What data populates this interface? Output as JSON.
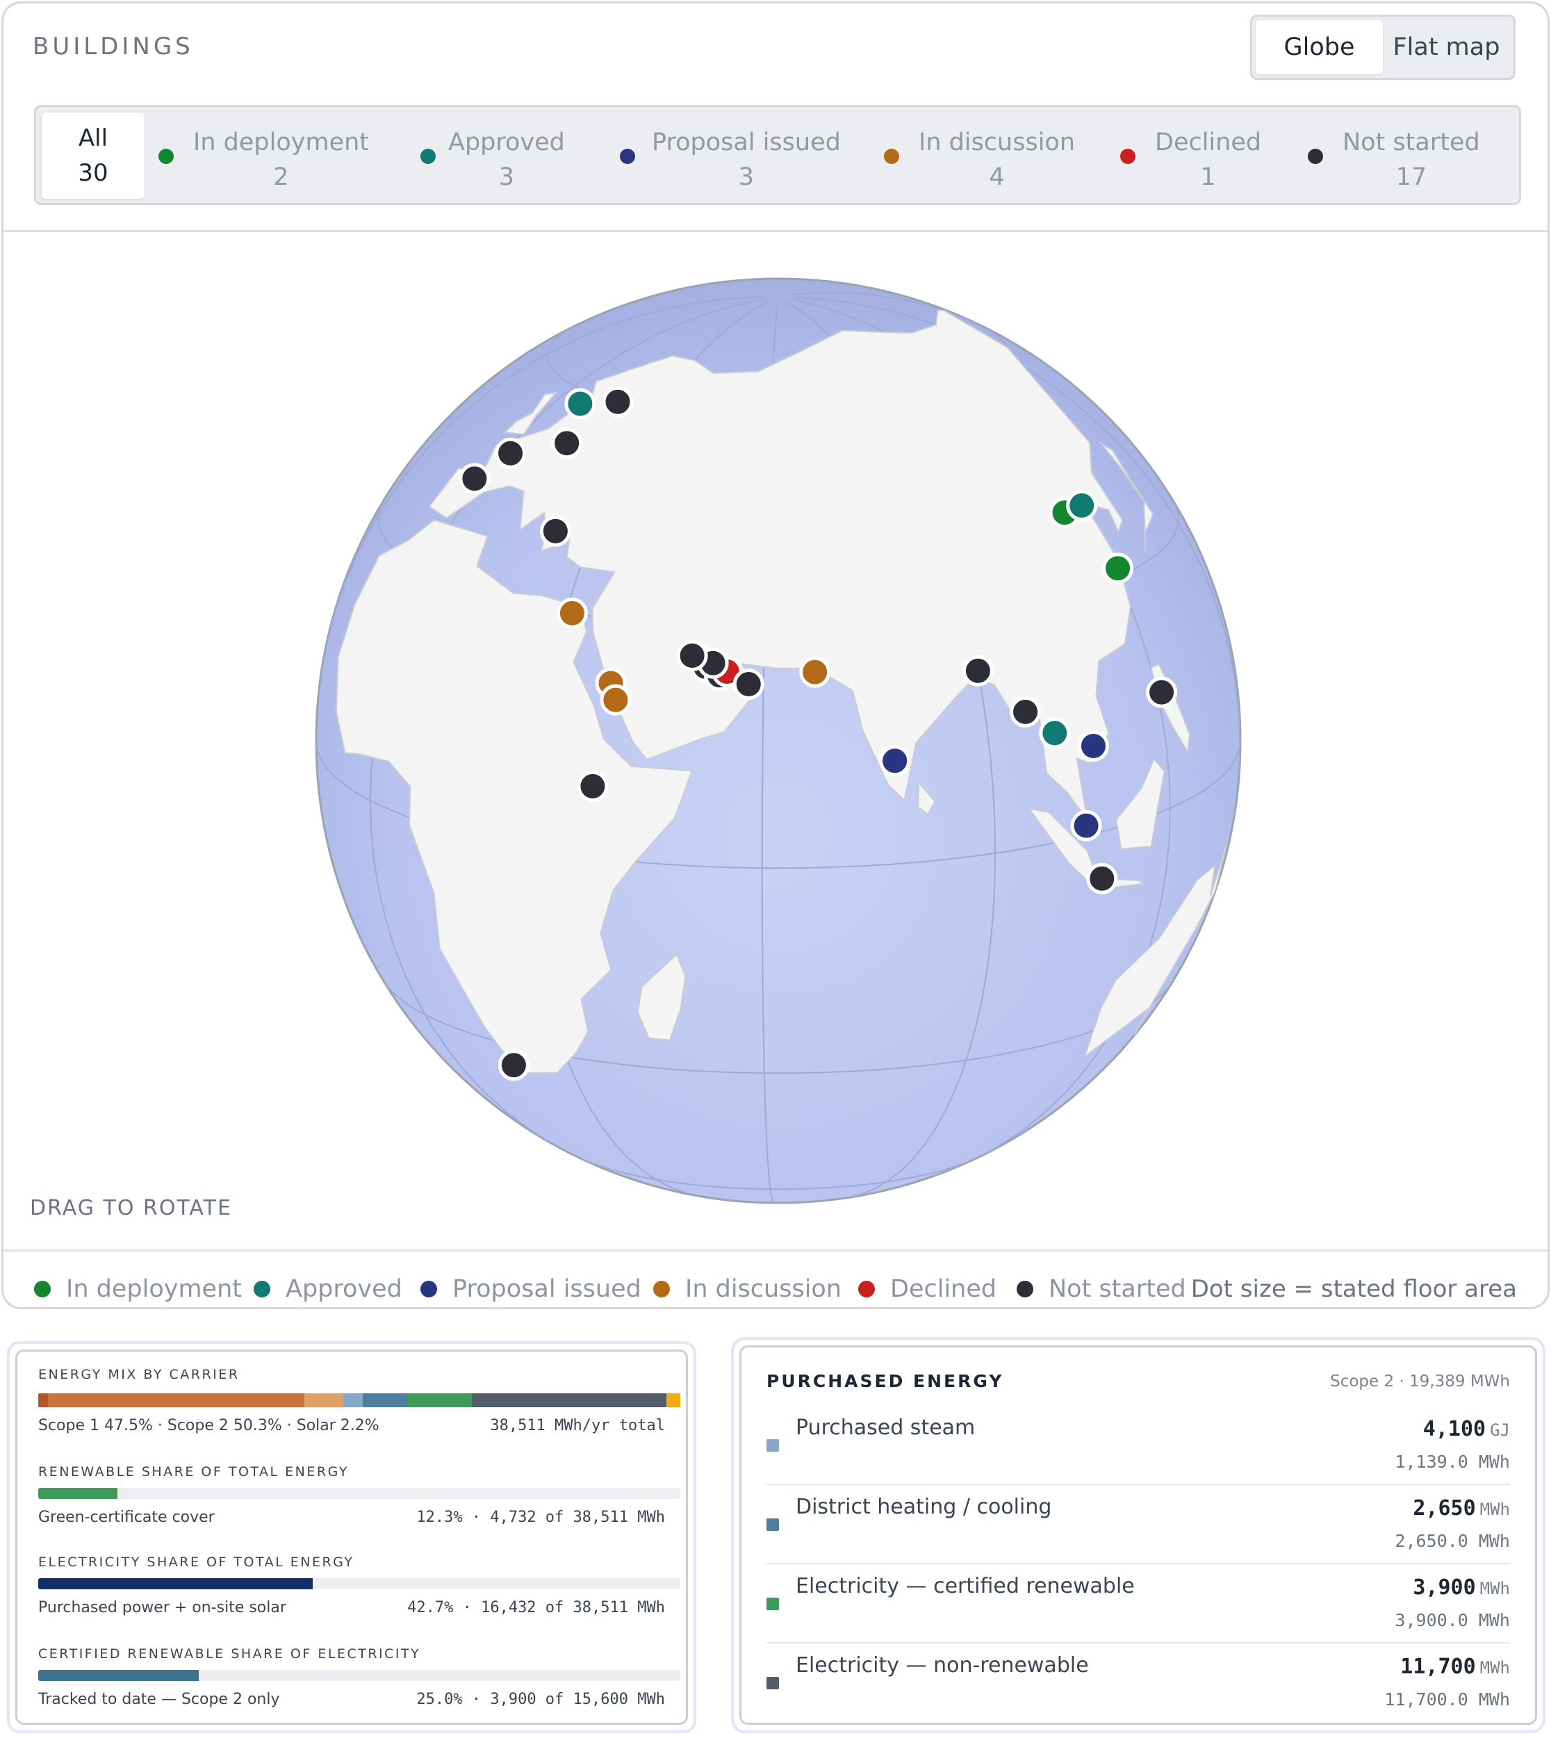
{
  "buildings": {
    "title": "BUILDINGS",
    "view_toggle": {
      "globe": "Globe",
      "flat_map": "Flat map",
      "active": "globe"
    },
    "filters": {
      "all": {
        "label": "All",
        "count": "30"
      },
      "items": [
        {
          "label": "In deployment",
          "count": "2",
          "color": "#12872f"
        },
        {
          "label": "Approved",
          "count": "3",
          "color": "#117a73"
        },
        {
          "label": "Proposal issued",
          "count": "3",
          "color": "#283580"
        },
        {
          "label": "In discussion",
          "count": "4",
          "color": "#b26a16"
        },
        {
          "label": "Declined",
          "count": "1",
          "color": "#c91f1f"
        },
        {
          "label": "Not started",
          "count": "17",
          "color": "#2c2d36"
        }
      ]
    },
    "drag_hint": "DRAG TO ROTATE",
    "legend": {
      "items": [
        {
          "label": "In deployment",
          "color": "#12872f"
        },
        {
          "label": "Approved",
          "color": "#117a73"
        },
        {
          "label": "Proposal issued",
          "color": "#283580"
        },
        {
          "label": "In discussion",
          "color": "#b26a16"
        },
        {
          "label": "Declined",
          "color": "#c91f1f"
        },
        {
          "label": "Not started",
          "color": "#2c2d36"
        }
      ],
      "note": "Dot size = stated floor area"
    },
    "globe": {
      "ocean_color": "#b8c3ef",
      "land_color": "#f4f4f4",
      "markers": [
        {
          "status": "approved",
          "lon": 8,
          "lat": 58
        },
        {
          "status": "not-started",
          "lon": 18,
          "lat": 60
        },
        {
          "status": "not-started",
          "lon": 14,
          "lat": 52
        },
        {
          "status": "not-started",
          "lon": 2,
          "lat": 48
        },
        {
          "status": "not-started",
          "lon": -2,
          "lat": 43
        },
        {
          "status": "not-started",
          "lon": 23,
          "lat": 40
        },
        {
          "status": "in-discussion",
          "lon": 31,
          "lat": 30
        },
        {
          "status": "in-discussion",
          "lon": 39,
          "lat": 22
        },
        {
          "status": "in-discussion",
          "lon": 40,
          "lat": 20
        },
        {
          "status": "not-started",
          "lon": 51,
          "lat": 26
        },
        {
          "status": "not-started",
          "lon": 52,
          "lat": 25
        },
        {
          "status": "not-started",
          "lon": 54,
          "lat": 24
        },
        {
          "status": "declined",
          "lon": 55,
          "lat": 24.5
        },
        {
          "status": "not-started",
          "lon": 58,
          "lat": 23
        },
        {
          "status": "in-discussion",
          "lon": 67,
          "lat": 24.5
        },
        {
          "status": "not-started",
          "lon": 38,
          "lat": 9
        },
        {
          "status": "proposal-issued",
          "lon": 77,
          "lat": 13
        },
        {
          "status": "not-started",
          "lon": 90,
          "lat": 23
        },
        {
          "status": "not-started",
          "lon": 96,
          "lat": 17
        },
        {
          "status": "approved",
          "lon": 100,
          "lat": 13.7
        },
        {
          "status": "proposal-issued",
          "lon": 106,
          "lat": 11
        },
        {
          "status": "proposal-issued",
          "lon": 103.8,
          "lat": 1.3
        },
        {
          "status": "not-started",
          "lon": 106.8,
          "lat": -6.2
        },
        {
          "status": "not-started",
          "lon": 121,
          "lat": 14.6
        },
        {
          "status": "in-deployment",
          "lon": 116,
          "lat": 40
        },
        {
          "status": "approved",
          "lon": 121,
          "lat": 40
        },
        {
          "status": "in-deployment",
          "lon": 121,
          "lat": 31
        },
        {
          "status": "not-started",
          "lon": 18.4,
          "lat": -33.9
        },
        {
          "status": "not-started",
          "lon": 53,
          "lat": 25.5
        },
        {
          "status": "not-started",
          "lon": 50,
          "lat": 26.3
        }
      ]
    }
  },
  "energy_mix": {
    "title": "ENERGY MIX BY CARRIER",
    "segments": [
      {
        "share": 1.5,
        "color": "#b5562a"
      },
      {
        "share": 40.0,
        "color": "#c8743a"
      },
      {
        "share": 6.0,
        "color": "#dea266"
      },
      {
        "share": 3.0,
        "color": "#88a8c8"
      },
      {
        "share": 7.0,
        "color": "#4d7f9e"
      },
      {
        "share": 10.0,
        "color": "#3f9a5a"
      },
      {
        "share": 30.3,
        "color": "#545e6a"
      },
      {
        "share": 2.2,
        "color": "#f0ac12"
      }
    ],
    "summary": "Scope 1 47.5% · Scope 2 50.3% · Solar 2.2%",
    "total": "38,511 MWh/yr total",
    "metrics": [
      {
        "title": "RENEWABLE SHARE OF TOTAL ENERGY",
        "percent": 12.3,
        "color": "#3f9a5a",
        "label": "Green-certificate cover",
        "value": "12.3% · 4,732 of 38,511 MWh"
      },
      {
        "title": "ELECTRICITY SHARE OF TOTAL ENERGY",
        "percent": 42.7,
        "color": "#12306b",
        "label": "Purchased power + on-site solar",
        "value": "42.7% · 16,432 of 38,511 MWh"
      },
      {
        "title": "CERTIFIED RENEWABLE SHARE OF ELECTRICITY",
        "percent": 25.0,
        "color": "#3d7290",
        "label": "Tracked to date — Scope 2 only",
        "value": "25.0% · 3,900 of 15,600 MWh"
      }
    ]
  },
  "purchased_energy": {
    "title": "PURCHASED ENERGY",
    "meta": "Scope 2 · 19,389 MWh",
    "rows": [
      {
        "name": "Purchased steam",
        "color": "#8aa7c8",
        "value": "4,100",
        "unit": "GJ",
        "secondary": "1,139.0 MWh"
      },
      {
        "name": "District heating / cooling",
        "color": "#4d7f9e",
        "value": "2,650",
        "unit": "MWh",
        "secondary": "2,650.0 MWh"
      },
      {
        "name": "Electricity — certified renewable",
        "color": "#3f9a5a",
        "value": "3,900",
        "unit": "MWh",
        "secondary": "3,900.0 MWh"
      },
      {
        "name": "Electricity — non-renewable",
        "color": "#545e6a",
        "value": "11,700",
        "unit": "MWh",
        "secondary": "11,700.0 MWh"
      }
    ]
  }
}
